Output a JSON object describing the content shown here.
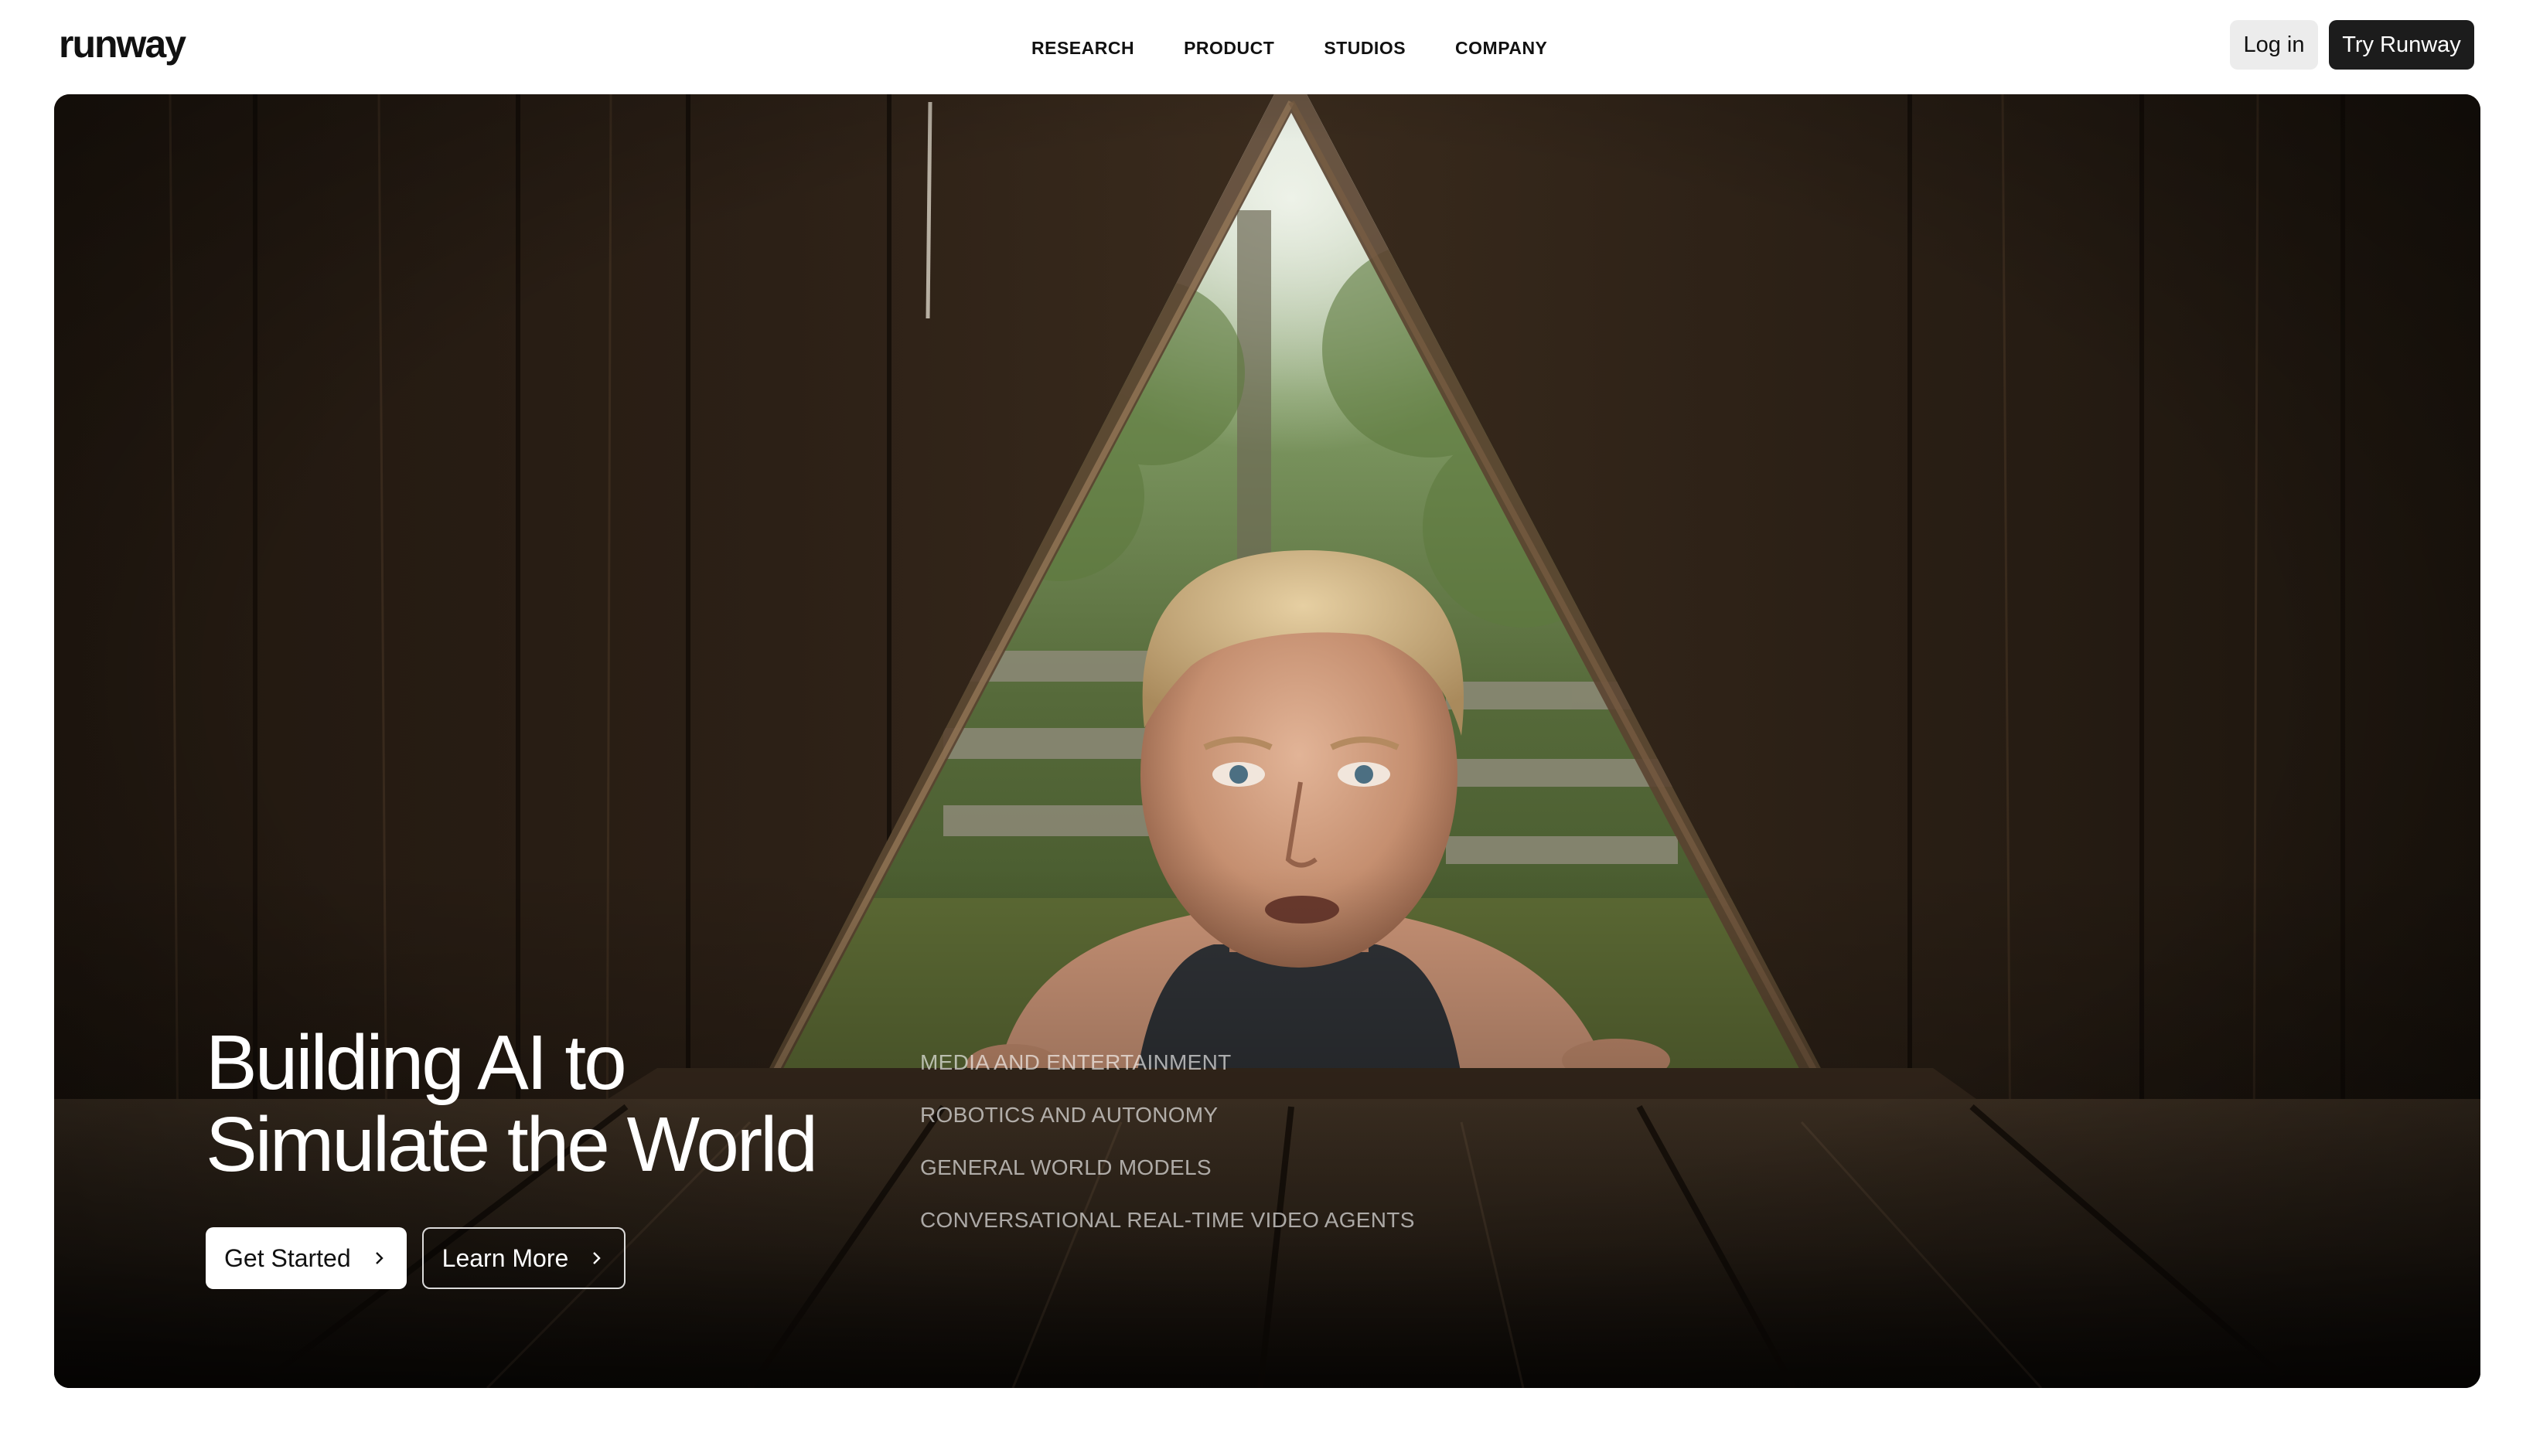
{
  "brand": {
    "logo_text": "runway"
  },
  "nav": {
    "items": [
      {
        "label": "RESEARCH"
      },
      {
        "label": "PRODUCT"
      },
      {
        "label": "STUDIOS"
      },
      {
        "label": "COMPANY"
      }
    ]
  },
  "header_actions": {
    "login_label": "Log in",
    "try_label": "Try Runway"
  },
  "hero": {
    "title_line_1": "Building AI to",
    "title_line_2": "Simulate the World",
    "get_started_label": "Get Started",
    "learn_more_label": "Learn More",
    "categories": [
      {
        "label": "MEDIA AND ENTERTAINMENT"
      },
      {
        "label": "ROBOTICS AND AUTONOMY"
      },
      {
        "label": "GENERAL WORLD MODELS"
      },
      {
        "label": "CONVERSATIONAL REAL-TIME VIDEO AGENTS"
      }
    ],
    "background_image": "man-peering-through-triangular-opening-in-wooden-barn"
  },
  "colors": {
    "page_bg": "#ffffff",
    "text_primary": "#111111",
    "login_bg": "#ececec",
    "try_bg": "#1c1c1c",
    "hero_bg": "#1a130d"
  }
}
